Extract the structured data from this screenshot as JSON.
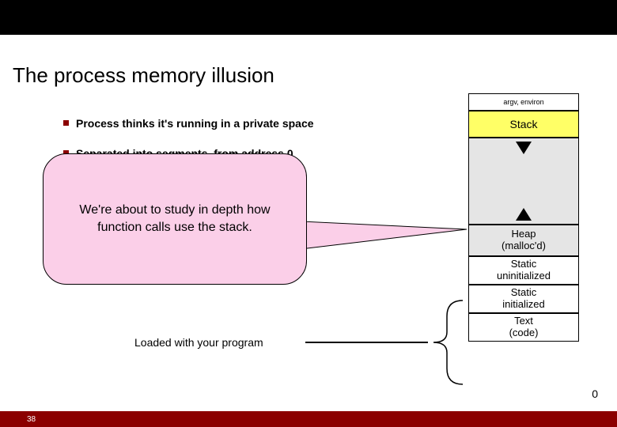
{
  "slide": {
    "title": "The process memory illusion",
    "number": "38"
  },
  "bullets": {
    "b1": "Process thinks it's running in a private space",
    "b2": "Separated into segments, from address 0"
  },
  "callout": {
    "text": "We're about to study in depth how function calls use the stack."
  },
  "loaded_label": "Loaded with your program",
  "memory": {
    "argv": "argv, environ",
    "stack": "Stack",
    "heap_l1": "Heap",
    "heap_l2": "(malloc'd)",
    "suninit_l1": "Static",
    "suninit_l2": "uninitialized",
    "sinit_l1": "Static",
    "sinit_l2": "initialized",
    "text_l1": "Text",
    "text_l2": "(code)",
    "zero": "0"
  }
}
